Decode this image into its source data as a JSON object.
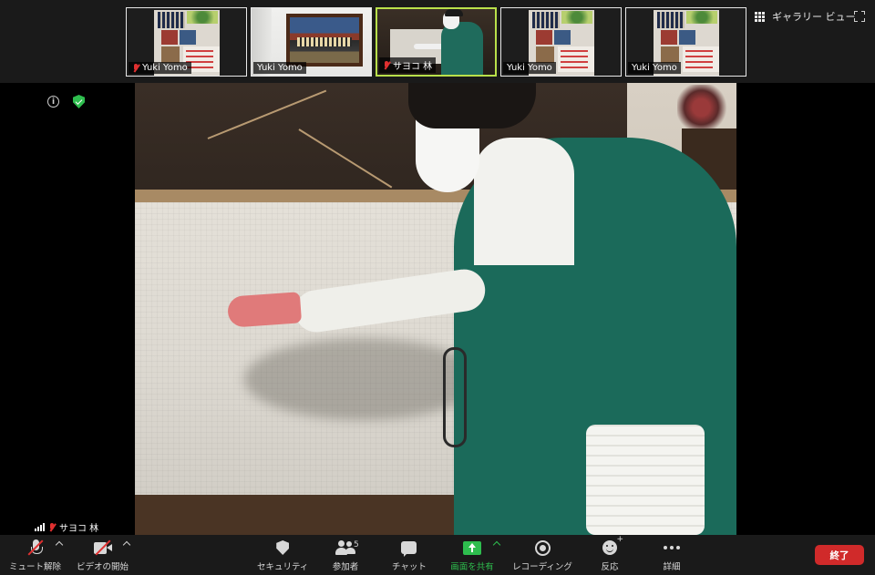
{
  "thumbnails": [
    {
      "name": "Yuki Yomo",
      "scene": "poster",
      "muted": true,
      "active": false
    },
    {
      "name": "Yuki Yomo",
      "scene": "painting",
      "muted": false,
      "active": false
    },
    {
      "name": "サヨコ 林",
      "scene": "person",
      "muted": true,
      "active": true
    },
    {
      "name": "Yuki Yomo",
      "scene": "poster",
      "muted": false,
      "active": false
    },
    {
      "name": "Yuki Yomo",
      "scene": "poster",
      "muted": false,
      "active": false
    }
  ],
  "view_toggle": {
    "label": "ギャラリー ビュー",
    "icon": "grid-icon"
  },
  "fullscreen": {
    "icon": "fullscreen-icon"
  },
  "meeting_info": {
    "icon": "info-icon"
  },
  "encryption": {
    "icon": "shield-check-icon",
    "color": "#2ebd4e"
  },
  "active_speaker": {
    "name": "サヨコ 林",
    "muted": true
  },
  "toolbar": {
    "unmute_label": "ミュート解除",
    "start_video_label": "ビデオの開始",
    "security_label": "セキュリティ",
    "participants_label": "参加者",
    "participants_count": "5",
    "chat_label": "チャット",
    "share_screen_label": "画面を共有",
    "record_label": "レコーディング",
    "reactions_label": "反応",
    "more_label": "詳細",
    "end_label": "終了"
  },
  "colors": {
    "accent_green": "#2ebd4e",
    "end_red": "#d02a2a",
    "active_thumb_border": "#b9e04a",
    "muted_red": "#e03030"
  }
}
